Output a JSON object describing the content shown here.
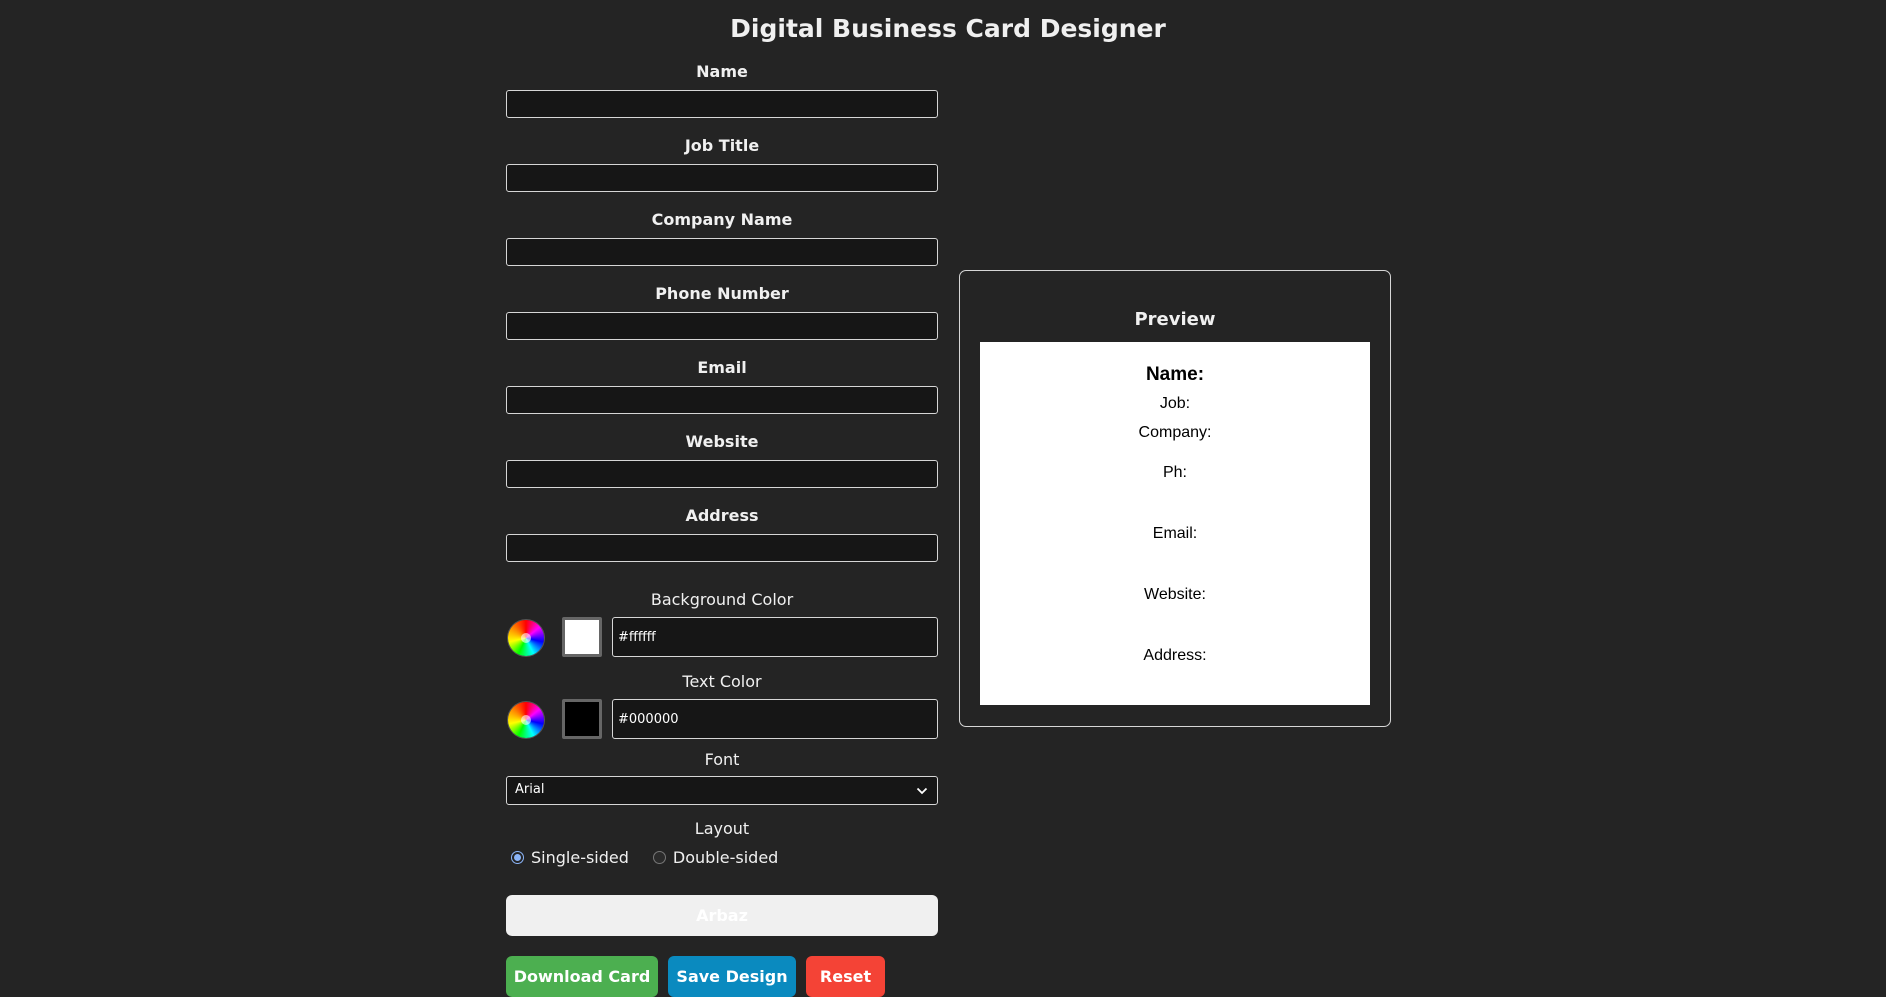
{
  "page": {
    "title": "Digital Business Card Designer"
  },
  "form": {
    "fields": [
      {
        "label": "Name",
        "value": ""
      },
      {
        "label": "Job Title",
        "value": ""
      },
      {
        "label": "Company Name",
        "value": ""
      },
      {
        "label": "Phone Number",
        "value": ""
      },
      {
        "label": "Email",
        "value": ""
      },
      {
        "label": "Website",
        "value": ""
      },
      {
        "label": "Address",
        "value": ""
      }
    ],
    "background_color": {
      "label": "Background Color",
      "value": "#ffffff",
      "swatch": "#ffffff"
    },
    "text_color": {
      "label": "Text Color",
      "value": "#000000",
      "swatch": "#000000"
    },
    "font": {
      "label": "Font",
      "selected": "Arial"
    },
    "layout": {
      "label": "Layout",
      "options": [
        {
          "label": "Single-sided",
          "checked": true
        },
        {
          "label": "Double-sided",
          "checked": false
        }
      ]
    },
    "name_bar_text": "Arbaz",
    "buttons": {
      "download": "Download Card",
      "save": "Save Design",
      "reset": "Reset"
    }
  },
  "preview": {
    "title": "Preview",
    "card": {
      "name": "Name:",
      "job": "Job:",
      "company": "Company:",
      "phone": "Ph:",
      "email": "Email:",
      "website": "Website:",
      "address": "Address:"
    }
  },
  "colors": {
    "page_background": "#242424",
    "download_button": "#4caf50",
    "save_button": "#0a8abf",
    "reset_button": "#f44336",
    "radio_accent": "#8ab4f8"
  }
}
